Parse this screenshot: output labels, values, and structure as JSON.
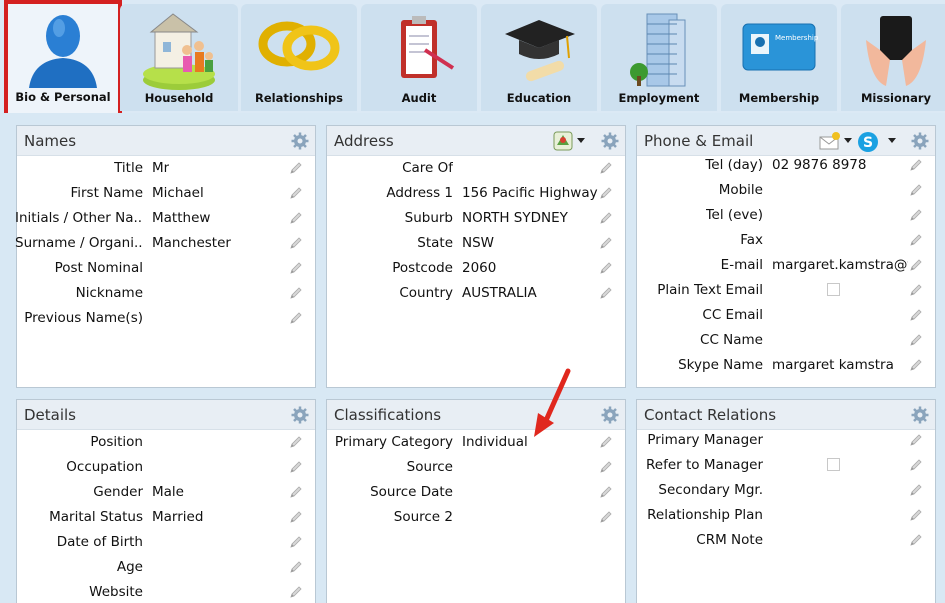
{
  "tabs": [
    {
      "label": "Bio & Personal",
      "icon": "person-icon",
      "active": true
    },
    {
      "label": "Household",
      "icon": "household-icon"
    },
    {
      "label": "Relationships",
      "icon": "rings-icon"
    },
    {
      "label": "Audit",
      "icon": "clipboard-icon"
    },
    {
      "label": "Education",
      "icon": "graduation-cap-icon"
    },
    {
      "label": "Employment",
      "icon": "office-building-icon"
    },
    {
      "label": "Membership",
      "icon": "membership-card-icon"
    },
    {
      "label": "Missionary",
      "icon": "hands-book-icon"
    }
  ],
  "membership_card_text": "Membership",
  "names": {
    "title": "Names",
    "rows": [
      {
        "label": "Title",
        "value": "Mr"
      },
      {
        "label": "First Name",
        "value": "Michael"
      },
      {
        "label": "Initials / Other Na...",
        "value": "Matthew"
      },
      {
        "label": "Surname / Organi...",
        "value": "Manchester"
      },
      {
        "label": "Post Nominal",
        "value": ""
      },
      {
        "label": "Nickname",
        "value": ""
      },
      {
        "label": "Previous Name(s)",
        "value": ""
      }
    ]
  },
  "address": {
    "title": "Address",
    "rows": [
      {
        "label": "Care Of",
        "value": ""
      },
      {
        "label": "Address 1",
        "value": "156 Pacific Highway"
      },
      {
        "label": "Suburb",
        "value": "NORTH SYDNEY"
      },
      {
        "label": "State",
        "value": "NSW"
      },
      {
        "label": "Postcode",
        "value": "2060"
      },
      {
        "label": "Country",
        "value": "AUSTRALIA"
      }
    ]
  },
  "phone": {
    "title": "Phone & Email",
    "rows": [
      {
        "label": "Tel (day)",
        "value": "02 9876 8978"
      },
      {
        "label": "Mobile",
        "value": ""
      },
      {
        "label": "Tel (eve)",
        "value": ""
      },
      {
        "label": "Fax",
        "value": ""
      },
      {
        "label": "E-mail",
        "value": "margaret.kamstra@th"
      },
      {
        "label": "Plain Text Email",
        "value": "",
        "checkbox": true
      },
      {
        "label": "CC Email",
        "value": ""
      },
      {
        "label": "CC Name",
        "value": ""
      },
      {
        "label": "Skype Name",
        "value": "margaret kamstra"
      }
    ]
  },
  "details": {
    "title": "Details",
    "rows": [
      {
        "label": "Position",
        "value": ""
      },
      {
        "label": "Occupation",
        "value": ""
      },
      {
        "label": "Gender",
        "value": "Male"
      },
      {
        "label": "Marital Status",
        "value": "Married"
      },
      {
        "label": "Date of Birth",
        "value": ""
      },
      {
        "label": "Age",
        "value": ""
      },
      {
        "label": "Website",
        "value": ""
      }
    ]
  },
  "classifications": {
    "title": "Classifications",
    "rows": [
      {
        "label": "Primary  Category",
        "value": "Individual"
      },
      {
        "label": "Source",
        "value": ""
      },
      {
        "label": "Source Date",
        "value": ""
      },
      {
        "label": "Source 2",
        "value": ""
      }
    ]
  },
  "contact_relations": {
    "title": "Contact Relations",
    "rows": [
      {
        "label": "Primary Manager",
        "value": ""
      },
      {
        "label": "Refer to Manager",
        "value": "",
        "checkbox": true
      },
      {
        "label": "Secondary Mgr.",
        "value": ""
      },
      {
        "label": "Relationship Plan",
        "value": ""
      },
      {
        "label": "CRM Note",
        "value": ""
      }
    ]
  },
  "colors": {
    "active_tab_border": "#d42020",
    "annotation_arrow": "#e0281e",
    "gear": "#8aa4bc",
    "skype": "#1ba1e2"
  }
}
